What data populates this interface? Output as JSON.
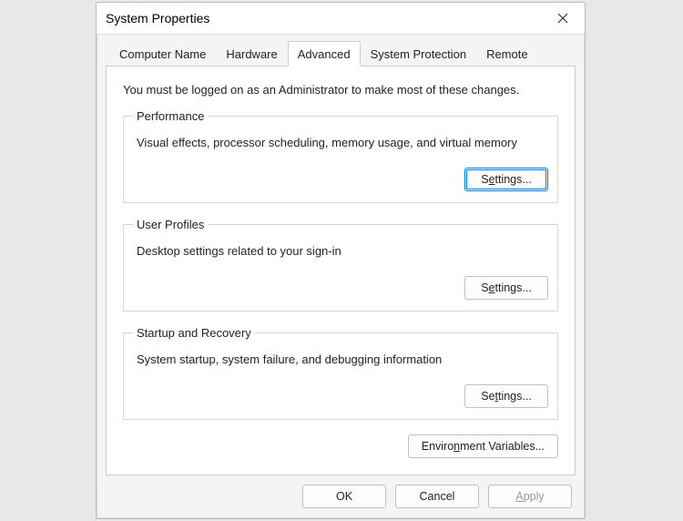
{
  "window": {
    "title": "System Properties"
  },
  "tabs": {
    "computer_name": "Computer Name",
    "hardware": "Hardware",
    "advanced": "Advanced",
    "system_protection": "System Protection",
    "remote": "Remote",
    "active": "advanced"
  },
  "panel": {
    "admin_note": "You must be logged on as an Administrator to make most of these changes.",
    "performance": {
      "legend": "Performance",
      "desc": "Visual effects, processor scheduling, memory usage, and virtual memory",
      "settings_btn_pre": "S",
      "settings_btn_u": "e",
      "settings_btn_post": "ttings..."
    },
    "user_profiles": {
      "legend": "User Profiles",
      "desc": "Desktop settings related to your sign-in",
      "settings_btn_pre": "S",
      "settings_btn_u": "e",
      "settings_btn_post": "ttings..."
    },
    "startup": {
      "legend": "Startup and Recovery",
      "desc": "System startup, system failure, and debugging information",
      "settings_btn_pre": "Se",
      "settings_btn_u": "t",
      "settings_btn_post": "tings..."
    },
    "env_btn_pre": "Enviro",
    "env_btn_u": "n",
    "env_btn_post": "ment Variables..."
  },
  "footer": {
    "ok": "OK",
    "cancel": "Cancel",
    "apply_u": "A",
    "apply_post": "pply"
  }
}
